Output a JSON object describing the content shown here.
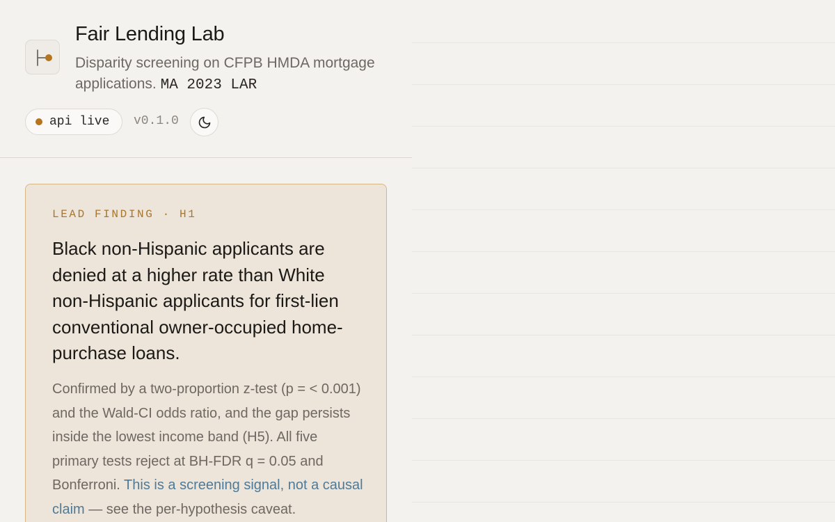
{
  "header": {
    "title": "Fair Lending Lab",
    "subtitle": "Disparity screening on CFPB HMDA mortgage applications.",
    "dataset": "MA 2023 LAR",
    "status_label": "api live",
    "version": "v0.1.0",
    "logo_icon": "branch-node-icon",
    "theme_icon": "moon-icon"
  },
  "lead_finding": {
    "eyebrow": "LEAD FINDING · H1",
    "headline": "Black non-Hispanic applicants are denied at a higher rate than White non-Hispanic applicants for first-lien conventional owner-occupied home-purchase loans.",
    "body_text": "Confirmed by a two-proportion z-test (p = < 0.001) and the Wald-CI odds ratio, and the gap persists inside the lowest income band (H5). All five primary tests reject at BH-FDR q = 0.05 and Bonferroni.",
    "caveat_link": "This is a screening signal, not a causal claim",
    "body_suffix": "— see the per-hypothesis caveat."
  },
  "colors": {
    "accent": "#b5741e",
    "card_background": "#ede5da",
    "card_border": "#d6b585",
    "link": "#4e7a98"
  }
}
